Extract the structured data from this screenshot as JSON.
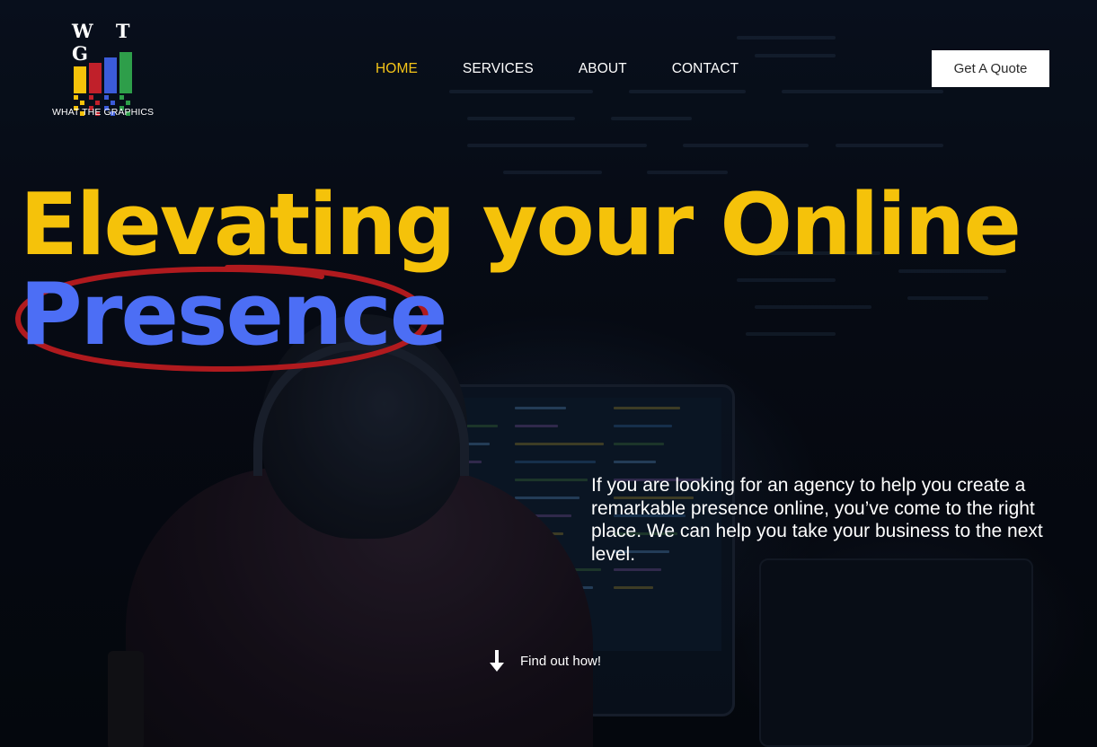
{
  "logo": {
    "letters": "W T G",
    "subtitle": "WHAT THE GRAPHICS",
    "bar_colors": [
      "#f5c20a",
      "#c0202a",
      "#3b5bd9",
      "#2e9e4a"
    ]
  },
  "nav": {
    "items": [
      {
        "label": "HOME",
        "active": true
      },
      {
        "label": "SERVICES",
        "active": false
      },
      {
        "label": "ABOUT",
        "active": false
      },
      {
        "label": "CONTACT",
        "active": false
      }
    ],
    "cta_label": "Get A Quote"
  },
  "hero": {
    "line1": "Elevating your Online",
    "line2": "Presence",
    "description": "If you are looking for an agency to help you create a remarkable presence online, you’ve come to the right place. We can help you take your business to the next level.",
    "find_out": "Find out how!"
  },
  "colors": {
    "accent_yellow": "#f5c20a",
    "accent_blue": "#4c6ef5",
    "circle_red": "#b01a1e",
    "nav_active": "#f5c518"
  }
}
